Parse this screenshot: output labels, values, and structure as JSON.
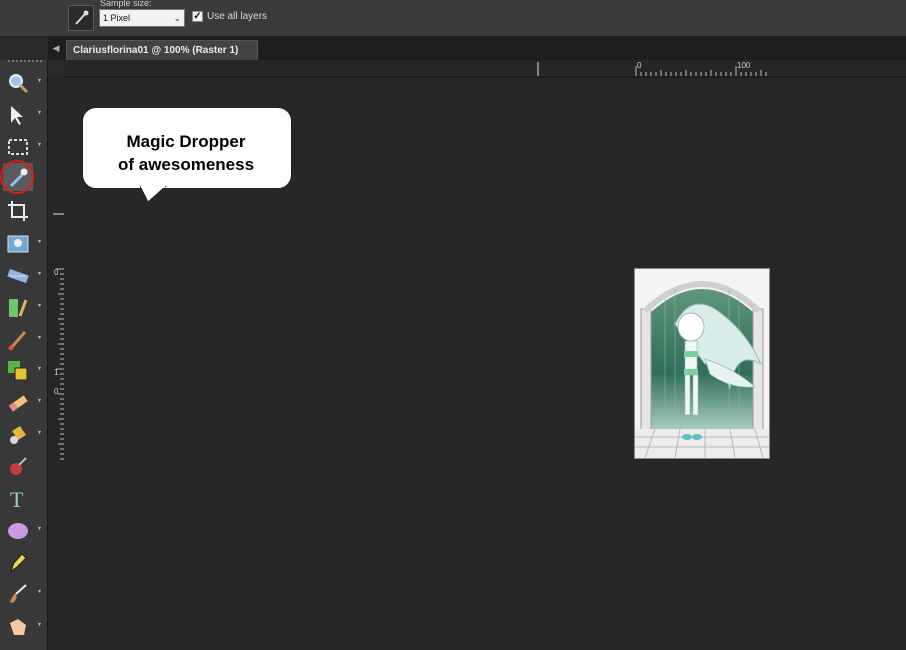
{
  "options": {
    "sample_size_label": "Sample size:",
    "sample_size_value": "1 Pixel",
    "use_all_layers_label": "Use all layers",
    "use_all_layers_checked": true
  },
  "document": {
    "tab_title": "Clariusflorina01 @ 100% (Raster 1)"
  },
  "rulers": {
    "top_labels": [
      "0",
      "100"
    ],
    "left_labels": [
      "0",
      "1",
      "0"
    ]
  },
  "annotation": {
    "line1": "Magic Dropper",
    "line2": "of awesomeness",
    "highlight_color": "#d61d1d"
  },
  "toolbox": {
    "tools": [
      {
        "name": "zoom-icon",
        "has_flyout": true
      },
      {
        "name": "pick-arrow-icon",
        "has_flyout": true
      },
      {
        "name": "selection-rectangle-icon",
        "has_flyout": true
      },
      {
        "name": "dropper-icon",
        "has_flyout": false,
        "active": true
      },
      {
        "name": "crop-icon",
        "has_flyout": false
      },
      {
        "name": "photo-fix-icon",
        "has_flyout": true
      },
      {
        "name": "straighten-icon",
        "has_flyout": true
      },
      {
        "name": "clone-brush-icon",
        "has_flyout": true
      },
      {
        "name": "paint-brush-icon",
        "has_flyout": true
      },
      {
        "name": "color-replacer-icon",
        "has_flyout": true
      },
      {
        "name": "eraser-icon",
        "has_flyout": true
      },
      {
        "name": "flood-fill-icon",
        "has_flyout": true
      },
      {
        "name": "picture-tube-icon",
        "has_flyout": false
      },
      {
        "name": "text-icon",
        "has_flyout": false
      },
      {
        "name": "ellipse-icon",
        "has_flyout": true
      },
      {
        "name": "pen-icon",
        "has_flyout": false
      },
      {
        "name": "art-brush-icon",
        "has_flyout": true
      },
      {
        "name": "smudge-icon",
        "has_flyout": true
      }
    ]
  }
}
